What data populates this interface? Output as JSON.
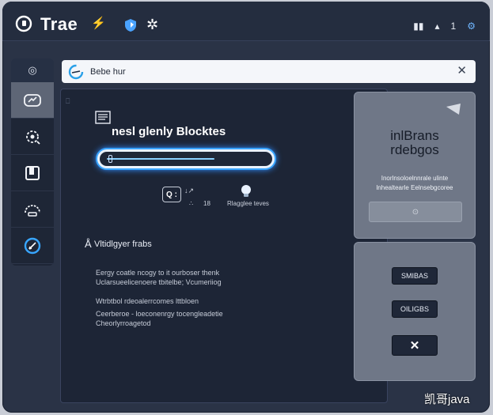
{
  "app": {
    "brand": "Trae",
    "brand_mark": "⚡",
    "puzzle_glyph": "✲"
  },
  "window_controls": [
    "▮▮",
    "▴",
    "1",
    "⚙"
  ],
  "rail": {
    "top_glyph": "◎",
    "items": [
      "dashboard-icon",
      "cog-icon",
      "layout-icon",
      "gauge-icon",
      "edit-icon"
    ],
    "active_index": 0
  },
  "search": {
    "value": "Bebe hur",
    "close": "✕"
  },
  "main": {
    "tab_glyph": "⎕",
    "heading": "nesl glenly Blocktes",
    "progress": 0.7,
    "ctrl_label": "Q :",
    "ctrl_side": "↓↗",
    "ctrl_sub_a": "∴",
    "ctrl_sub_b": "18",
    "bulb_label": "Rlagglee teves",
    "section_caret": "Å",
    "section_title": "Vltidlgyer frabs",
    "paragraphs": [
      "Eergy coatle ncogy to it ourboser thenk",
      "Uclarsueelicenoere tbitelbe; Vcumeriiog",
      "Wtrbtbol rdeoalerrcomes lttbloen",
      "Ceerberoe - loeconenrgy  tocengleadetie",
      "Cheorlyrroagetod"
    ]
  },
  "card_top": {
    "title_line1": "inlBrans",
    "title_line2": "rdebgos",
    "sub1": "Inorlnsoloelnnrale ulinte",
    "sub2": "lnhealtearle Eelnsebgcoree",
    "input_glyph": "⊙"
  },
  "card_bottom": {
    "buttons": [
      "SMIBAS",
      "OILIGBS",
      "✕"
    ]
  },
  "watermark": "凯哥java"
}
